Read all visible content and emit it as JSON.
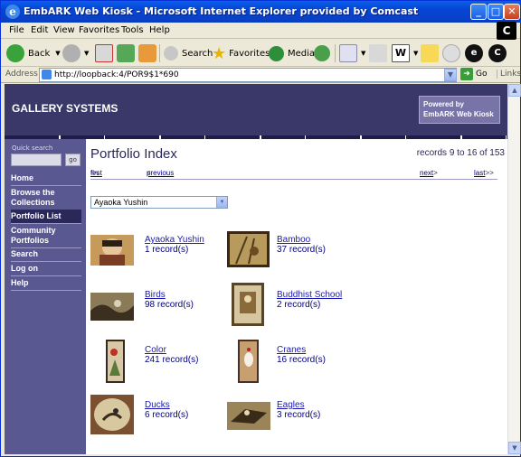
{
  "window": {
    "title": "EmbARK Web Kiosk - Microsoft Internet Explorer provided by Comcast"
  },
  "menu": [
    "File",
    "Edit",
    "View",
    "Favorites",
    "Tools",
    "Help"
  ],
  "toolbar": {
    "back": "Back",
    "search": "Search",
    "favorites": "Favorites",
    "media": "Media"
  },
  "address": {
    "label": "Address",
    "url": "http://loopback:4/POR9$1*690",
    "go": "Go",
    "links": "Links"
  },
  "site": {
    "brand": "GALLERY SYSTEMS",
    "powered_line1": "Powered by",
    "powered_line2": "EmbARK Web Kiosk"
  },
  "sidebar": {
    "quick_search_label": "Quick search",
    "go": "go",
    "items": [
      {
        "label": "Home"
      },
      {
        "label": "Browse the Collections"
      },
      {
        "label": "Portfolio List",
        "active": true
      },
      {
        "label": "Community Portfolios"
      },
      {
        "label": "Search"
      },
      {
        "label": "Log on"
      },
      {
        "label": "Help"
      }
    ]
  },
  "main": {
    "title": "Portfolio Index",
    "records": "records 9 to 16 of 153",
    "pager": {
      "first": "first",
      "previous": "previous",
      "next": "next",
      "last": "last",
      "lt": "<<",
      "lt1": "<",
      "gt": ">",
      "gt2": ">>"
    },
    "select_value": "Ayaoka Yushin",
    "portfolios": [
      {
        "name": "Ayaoka Yushin",
        "count": "1 record(s)"
      },
      {
        "name": "Bamboo",
        "count": "37 record(s)"
      },
      {
        "name": "Birds",
        "count": "98 record(s)"
      },
      {
        "name": "Buddhist School",
        "count": "2 record(s)"
      },
      {
        "name": "Color",
        "count": "241 record(s)"
      },
      {
        "name": "Cranes",
        "count": "16 record(s)"
      },
      {
        "name": "Ducks",
        "count": "6 record(s)"
      },
      {
        "name": "Eagles",
        "count": "3 record(s)"
      }
    ]
  }
}
